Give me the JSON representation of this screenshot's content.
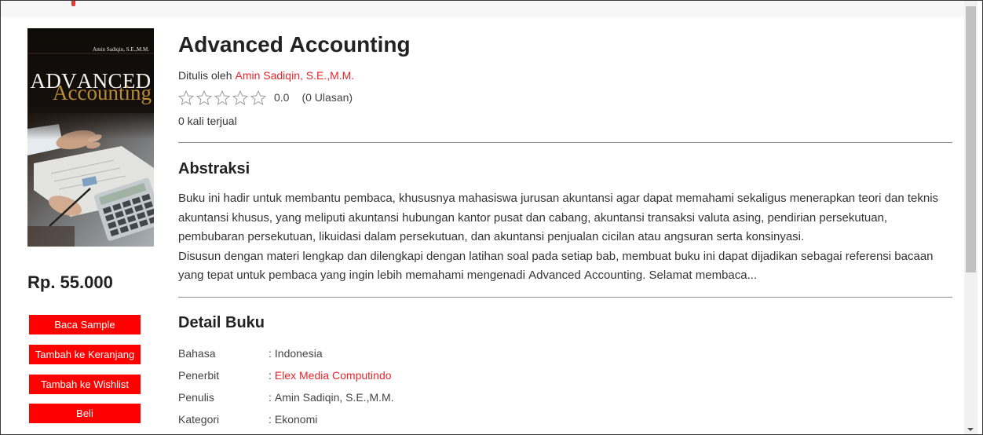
{
  "colors": {
    "button": "#ff0000",
    "button_text": "#ffffff",
    "link": "#e8252b",
    "text": "#333333",
    "heading": "#222222",
    "divider": "#8f8f8f",
    "star_outline": "#9a9a9a",
    "star_filled": "#f5b301"
  },
  "icons": {
    "rating_star": "star-outline-icon",
    "scroll_down": "chevron-down-icon"
  },
  "cover": {
    "author": "Amin Sadiqin, S.E.,M.M.",
    "title_line1": "ADVANCED",
    "title_line2": "Accounting"
  },
  "price": "Rp. 55.000",
  "actions": [
    {
      "label": "Baca Sample"
    },
    {
      "label": "Tambah ke Keranjang"
    },
    {
      "label": "Tambah ke Wishlist"
    },
    {
      "label": "Beli"
    }
  ],
  "book": {
    "title": "Advanced Accounting",
    "author_prefix": "Ditulis oleh",
    "author": "Amin Sadiqin, S.E.,M.M.",
    "rating": {
      "stars_filled": 0,
      "stars_total": 5,
      "value": "0.0",
      "reviews": "(0 Ulasan)"
    },
    "sold": "0 kali terjual"
  },
  "abstract": {
    "heading": "Abstraksi",
    "paragraphs": [
      "Buku ini hadir untuk membantu pembaca, khususnya mahasiswa jurusan akuntansi agar dapat memahami sekaligus menerapkan teori dan teknis akuntansi khusus, yang meliputi akuntansi hubungan kantor pusat dan cabang, akuntansi transaksi valuta asing, pendirian persekutuan, pembubaran persekutuan, likuidasi dalam persekutuan, dan akuntansi penjualan cicilan atau angsuran serta konsinyasi.",
      "Disusun dengan materi lengkap dan dilengkapi dengan latihan soal pada setiap bab, membuat buku ini dapat dijadikan sebagai referensi bacaan yang tepat untuk pembaca yang ingin lebih memahami mengenadi Advanced Accounting. Selamat membaca..."
    ]
  },
  "details": {
    "heading": "Detail Buku",
    "separator": ":",
    "rows": [
      {
        "label": "Bahasa",
        "value": "Indonesia",
        "is_link": false
      },
      {
        "label": "Penerbit",
        "value": "Elex Media Computindo",
        "is_link": true
      },
      {
        "label": "Penulis",
        "value": "Amin Sadiqin, S.E.,M.M.",
        "is_link": false
      },
      {
        "label": "Kategori",
        "value": "Ekonomi",
        "is_link": false
      }
    ]
  }
}
